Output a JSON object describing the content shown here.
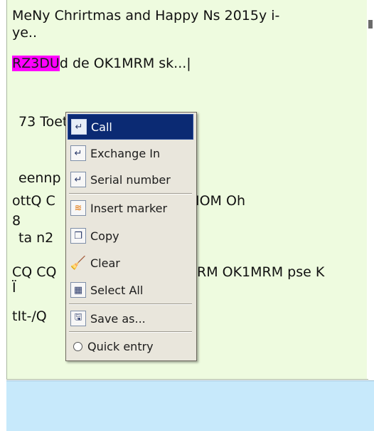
{
  "rx_text": {
    "line1": "MeNy Chrirtmas and Happy Ns 2015y  i-",
    "line2": "ye..",
    "line3_highlight": "RZ3DU",
    "line3_rest": "d de OK1MRM sk...|",
    "line4": "73 Toet",
    "line5_left": "eennp",
    "line6_left": "ottQ C",
    "line6_right": "IOM Oh",
    "line7": "8",
    "line8": "ta  n2",
    "line9_left": "CQ CQ",
    "line9_right": "RM OK1MRM pse K",
    "line10": "Ï",
    "line11": "tIt-/Q"
  },
  "menu": {
    "items": [
      {
        "label": "Call",
        "icon": "return-arrow-icon"
      },
      {
        "label": "Exchange In",
        "icon": "return-arrow-icon"
      },
      {
        "label": "Serial number",
        "icon": "return-arrow-icon"
      },
      {
        "label": "Insert marker",
        "icon": "marker-icon"
      },
      {
        "label": "Copy",
        "icon": "copy-icon"
      },
      {
        "label": "Clear",
        "icon": "broom-icon"
      },
      {
        "label": "Select All",
        "icon": "select-all-icon"
      },
      {
        "label": "Save as...",
        "icon": "save-icon"
      },
      {
        "label": "Quick entry",
        "icon": "checkbox-icon"
      }
    ]
  },
  "colors": {
    "rx_background": "#eefbdf",
    "tx_background": "#c7e9fb",
    "highlight": "#ff00ff",
    "menu_selected": "#0b2a73"
  }
}
